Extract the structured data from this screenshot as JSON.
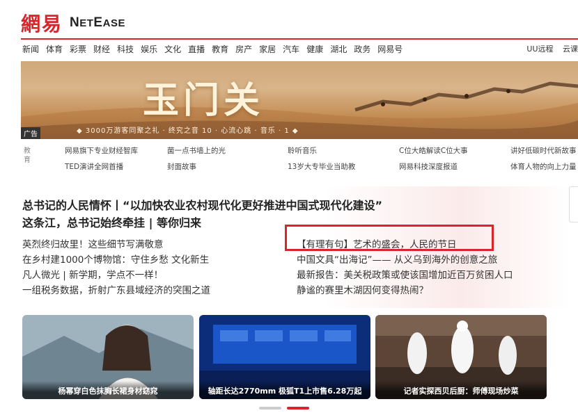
{
  "logo": {
    "cn": "網易",
    "en_big1": "N",
    "en_small1": "ET",
    "en_big2": "E",
    "en_small2": "ASE"
  },
  "nav": [
    "新闻",
    "体育",
    "彩票",
    "财经",
    "科技",
    "娱乐",
    "文化",
    "直播",
    "教育",
    "房产",
    "家居",
    "汽车",
    "健康",
    "湖北",
    "政务",
    "网易号"
  ],
  "nav_right": [
    "UU远程",
    "云课"
  ],
  "banner": {
    "title": "玉门关",
    "ad_tag": "广告",
    "subtitle": "◆ 3000万游客同聚之礼 · 终究之音 10 · 心流心跳 · 音乐 · 1 ◆"
  },
  "education": {
    "label": "教育",
    "links": [
      "网易旗下专业财经智库",
      "菌一点书墙上的光",
      "聆听音乐",
      "C位大皓解读C位大事",
      "讲好低碳时代新故事",
      "TED演讲全网首播",
      "封面故事",
      "13岁大专毕业当助教",
      "网易科技深度报道",
      "体育人物的向上力量"
    ]
  },
  "headlines": [
    "总书记的人民情怀丨“以加快农业农村现代化更好推进中国式现代化建设”",
    "这条江，总书记始终牵挂 | 等你归来"
  ],
  "news_left": [
    "英烈终归故里！这些细节写满敬意",
    "在乡村建1000个博物馆：守住乡愁 文化新生",
    "凡人微光 | 新学期，学点不一样！",
    "一组税务数据，折射广东县域经济的突围之道"
  ],
  "news_right": [
    "【有理有句】艺术的盛会，人民的节日",
    "中国文具“出海记”—— 从义乌到海外的创意之旅",
    "最新报告：美关税政策或使该国增加近百万贫困人口",
    "静谧的赛里木湖因何变得热闹？"
  ],
  "cards": [
    {
      "caption": "杨幂穿白色抹胸长裙身材窈窕"
    },
    {
      "caption": "轴距长达2770mm 极狐T1上市售6.28万起"
    },
    {
      "caption": "记者实探西贝后厨：师傅现场炒菜"
    }
  ],
  "colors": {
    "brand_red": "#d9252a"
  }
}
